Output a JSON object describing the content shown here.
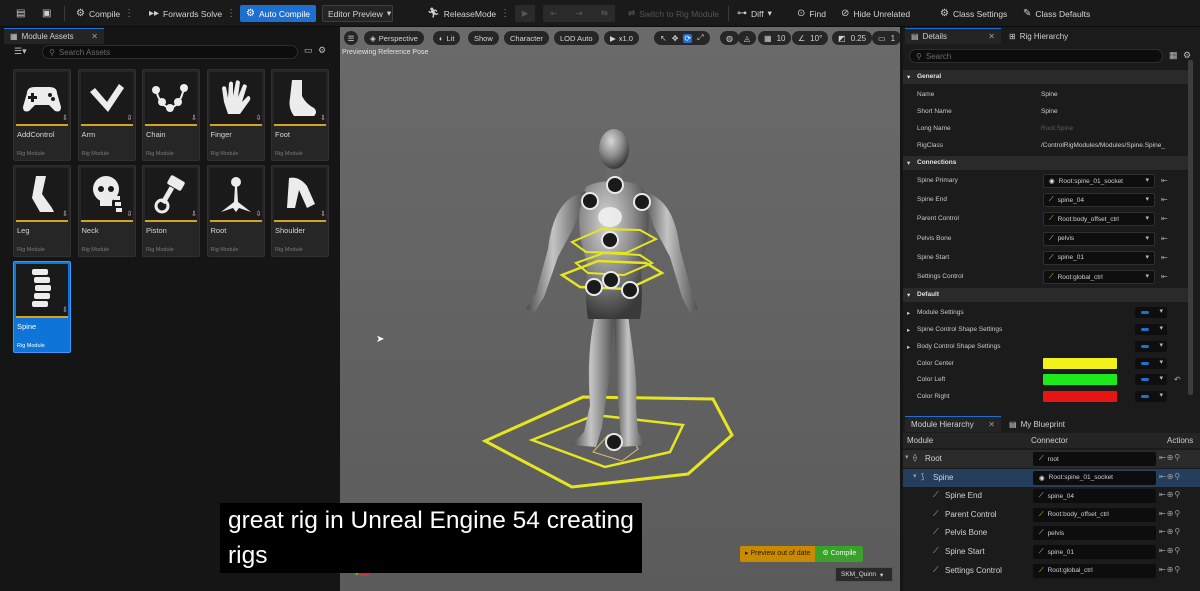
{
  "toolbar": {
    "compile": "Compile",
    "forwards_solve": "Forwards Solve",
    "auto_compile": "Auto Compile",
    "editor_preview": "Editor Preview",
    "release_mode": "ReleaseMode",
    "switch_rig_module": "Switch to Rig Module",
    "diff": "Diff",
    "find": "Find",
    "hide_unrelated": "Hide Unrelated",
    "class_settings": "Class Settings",
    "class_defaults": "Class Defaults"
  },
  "module_assets": {
    "tab_title": "Module Assets",
    "search_placeholder": "Search Assets",
    "tiles": [
      {
        "name": "AddControl",
        "type": "Rig Module",
        "icon": "gamepad-icon"
      },
      {
        "name": "Arm",
        "type": "Rig Module",
        "icon": "arm-icon"
      },
      {
        "name": "Chain",
        "type": "Rig Module",
        "icon": "chain-icon"
      },
      {
        "name": "Finger",
        "type": "Rig Module",
        "icon": "hand-icon"
      },
      {
        "name": "Foot",
        "type": "Rig Module",
        "icon": "foot-icon"
      },
      {
        "name": "Leg",
        "type": "Rig Module",
        "icon": "leg-icon"
      },
      {
        "name": "Neck",
        "type": "Rig Module",
        "icon": "skull-icon"
      },
      {
        "name": "Piston",
        "type": "Rig Module",
        "icon": "piston-icon"
      },
      {
        "name": "Root",
        "type": "Rig Module",
        "icon": "root-icon"
      },
      {
        "name": "Shoulder",
        "type": "Rig Module",
        "icon": "shoulder-icon"
      },
      {
        "name": "Spine",
        "type": "Rig Module",
        "icon": "spine-icon",
        "selected": true
      }
    ]
  },
  "viewport": {
    "perspective": "Perspective",
    "lit": "Lit",
    "show": "Show",
    "character": "Character",
    "lod": "LOD Auto",
    "speed": "x1.0",
    "grid_size": "10",
    "rotation_snap": "10°",
    "scale_snap": "0.25",
    "camera_speed": "1",
    "preview_label": "Previewing Reference Pose",
    "preview_out_of_date": "Preview out of date",
    "compile_badge": "Compile",
    "mesh_selector": "SKM_Quinn"
  },
  "subtitle": {
    "line1": "great rig in Unreal Engine 54 creating",
    "line2": "rigs"
  },
  "details": {
    "tab_details": "Details",
    "tab_rig_hierarchy": "Rig Hierarchy",
    "search_placeholder": "Search",
    "general_header": "General",
    "general": [
      {
        "label": "Name",
        "value": "Spine"
      },
      {
        "label": "Short Name",
        "value": "Spine"
      },
      {
        "label": "Long Name",
        "value": "Root:Spine"
      },
      {
        "label": "RigClass",
        "value": "/ControlRigModules/Modules/Spine.Spine_"
      }
    ],
    "connections_header": "Connections",
    "connections": [
      {
        "label": "Spine Primary",
        "value": "Root:spine_01_socket"
      },
      {
        "label": "Spine End",
        "value": "spine_04"
      },
      {
        "label": "Parent Control",
        "value": "Root:body_offset_ctrl"
      },
      {
        "label": "Pelvis Bone",
        "value": "pelvis"
      },
      {
        "label": "Spine Start",
        "value": "spine_01"
      },
      {
        "label": "Settings Control",
        "value": "Root:global_ctrl"
      }
    ],
    "default_header": "Default",
    "defaults": [
      {
        "label": "Module Settings"
      },
      {
        "label": "Spine Control Shape Settings"
      },
      {
        "label": "Body Control Shape Settings"
      },
      {
        "label": "Color Center",
        "color": "#f2f21a"
      },
      {
        "label": "Color Left",
        "color": "#1ee81e"
      },
      {
        "label": "Color Right",
        "color": "#e81414"
      }
    ]
  },
  "module_hierarchy": {
    "tab_title": "Module Hierarchy",
    "tab_blueprint": "My Blueprint",
    "col_module": "Module",
    "col_connector": "Connector",
    "col_actions": "Actions",
    "rows": [
      {
        "module": "Root",
        "connector": "root"
      },
      {
        "module": "Spine",
        "connector": "Root:spine_01_socket"
      },
      {
        "module": "Spine End",
        "connector": "spine_04"
      },
      {
        "module": "Parent Control",
        "connector": "Root:body_offset_ctrl"
      },
      {
        "module": "Pelvis Bone",
        "connector": "pelvis"
      },
      {
        "module": "Spine Start",
        "connector": "spine_01"
      },
      {
        "module": "Settings Control",
        "connector": "Root:global_ctrl"
      }
    ]
  }
}
